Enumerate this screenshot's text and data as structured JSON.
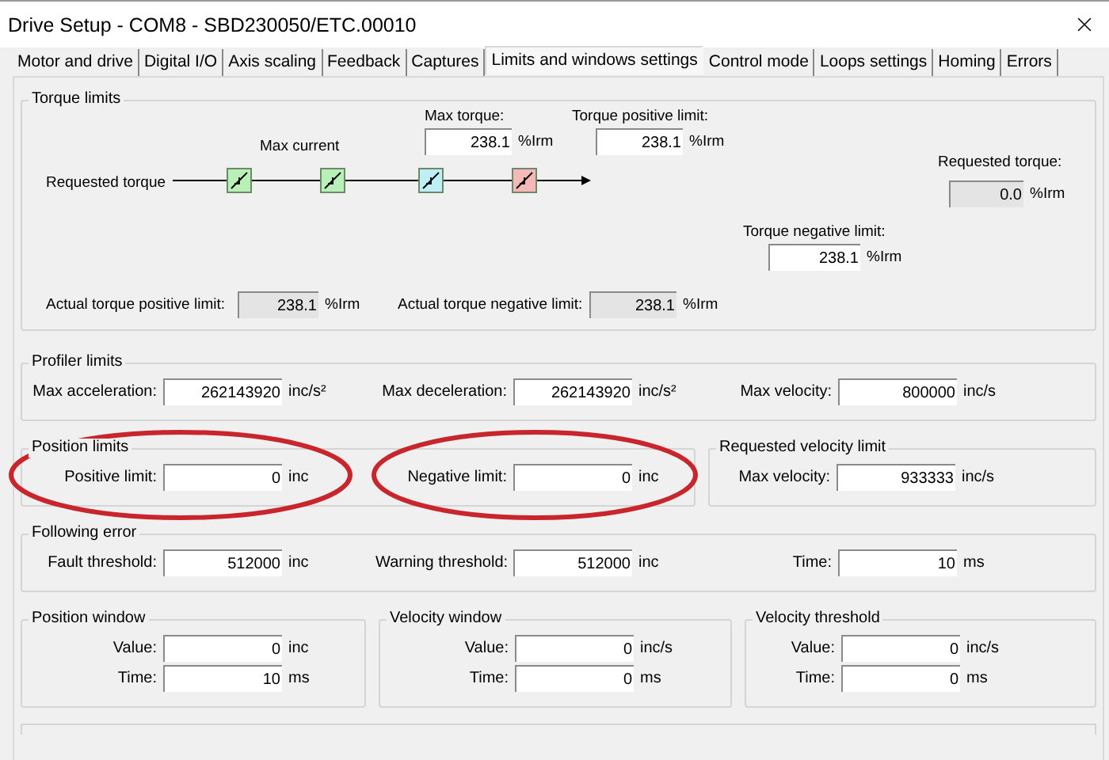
{
  "window": {
    "title": "Drive Setup - COM8 - SBD230050/ETC.00010"
  },
  "tabs": [
    {
      "label": "Motor and drive",
      "selected": false
    },
    {
      "label": "Digital I/O",
      "selected": false
    },
    {
      "label": "Axis scaling",
      "selected": false
    },
    {
      "label": "Feedback",
      "selected": false
    },
    {
      "label": "Captures",
      "selected": false
    },
    {
      "label": "Limits and windows settings",
      "selected": true
    },
    {
      "label": "Control mode",
      "selected": false
    },
    {
      "label": "Loops settings",
      "selected": false
    },
    {
      "label": "Homing",
      "selected": false
    },
    {
      "label": "Errors",
      "selected": false
    }
  ],
  "torque_limits": {
    "title": "Torque limits",
    "input_label": "Requested torque",
    "stage_label": "Max current",
    "blocks": [
      {
        "color": "#b8f0b8"
      },
      {
        "color": "#b8f0b8"
      },
      {
        "color": "#bfeef6"
      },
      {
        "color": "#f4b8b8"
      }
    ],
    "fields": [
      {
        "label": "Max torque:",
        "value": "238.1",
        "unit": "%Irm",
        "readonly": false
      },
      {
        "label": "Torque positive limit:",
        "value": "238.1",
        "unit": "%Irm",
        "readonly": false
      },
      {
        "label": "Requested torque:",
        "value": "0.0",
        "unit": "%Irm",
        "readonly": true
      },
      {
        "label": "Torque negative limit:",
        "value": "238.1",
        "unit": "%Irm",
        "readonly": false
      },
      {
        "label": "Actual torque positive limit:",
        "value": "238.1",
        "unit": "%Irm",
        "readonly": true
      },
      {
        "label": "Actual torque negative limit:",
        "value": "238.1",
        "unit": "%Irm",
        "readonly": true
      }
    ]
  },
  "profiler_limits": {
    "title": "Profiler limits",
    "fields": [
      {
        "label": "Max acceleration:",
        "value": "262143920",
        "unit": "inc/s²"
      },
      {
        "label": "Max deceleration:",
        "value": "262143920",
        "unit": "inc/s²"
      },
      {
        "label": "Max velocity:",
        "value": "800000",
        "unit": "inc/s"
      }
    ]
  },
  "position_limits": {
    "title": "Position limits",
    "fields": [
      {
        "label": "Positive limit:",
        "value": "0",
        "unit": "inc",
        "circled": true
      },
      {
        "label": "Negative limit:",
        "value": "0",
        "unit": "inc",
        "circled": true
      }
    ]
  },
  "requested_velocity_limit": {
    "title": "Requested velocity limit",
    "fields": [
      {
        "label": "Max velocity:",
        "value": "933333",
        "unit": "inc/s"
      }
    ]
  },
  "following_error": {
    "title": "Following error",
    "fields": [
      {
        "label": "Fault threshold:",
        "value": "512000",
        "unit": "inc"
      },
      {
        "label": "Warning threshold:",
        "value": "512000",
        "unit": "inc"
      },
      {
        "label": "Time:",
        "value": "10",
        "unit": "ms"
      }
    ]
  },
  "windows": [
    {
      "title": "Position window",
      "fields": [
        {
          "label": "Value:",
          "value": "0",
          "unit": "inc"
        },
        {
          "label": "Time:",
          "value": "10",
          "unit": "ms"
        }
      ]
    },
    {
      "title": "Velocity window",
      "fields": [
        {
          "label": "Value:",
          "value": "0",
          "unit": "inc/s"
        },
        {
          "label": "Time:",
          "value": "0",
          "unit": "ms"
        }
      ]
    },
    {
      "title": "Velocity threshold",
      "fields": [
        {
          "label": "Value:",
          "value": "0",
          "unit": "inc/s"
        },
        {
          "label": "Time:",
          "value": "0",
          "unit": "ms"
        }
      ]
    }
  ]
}
